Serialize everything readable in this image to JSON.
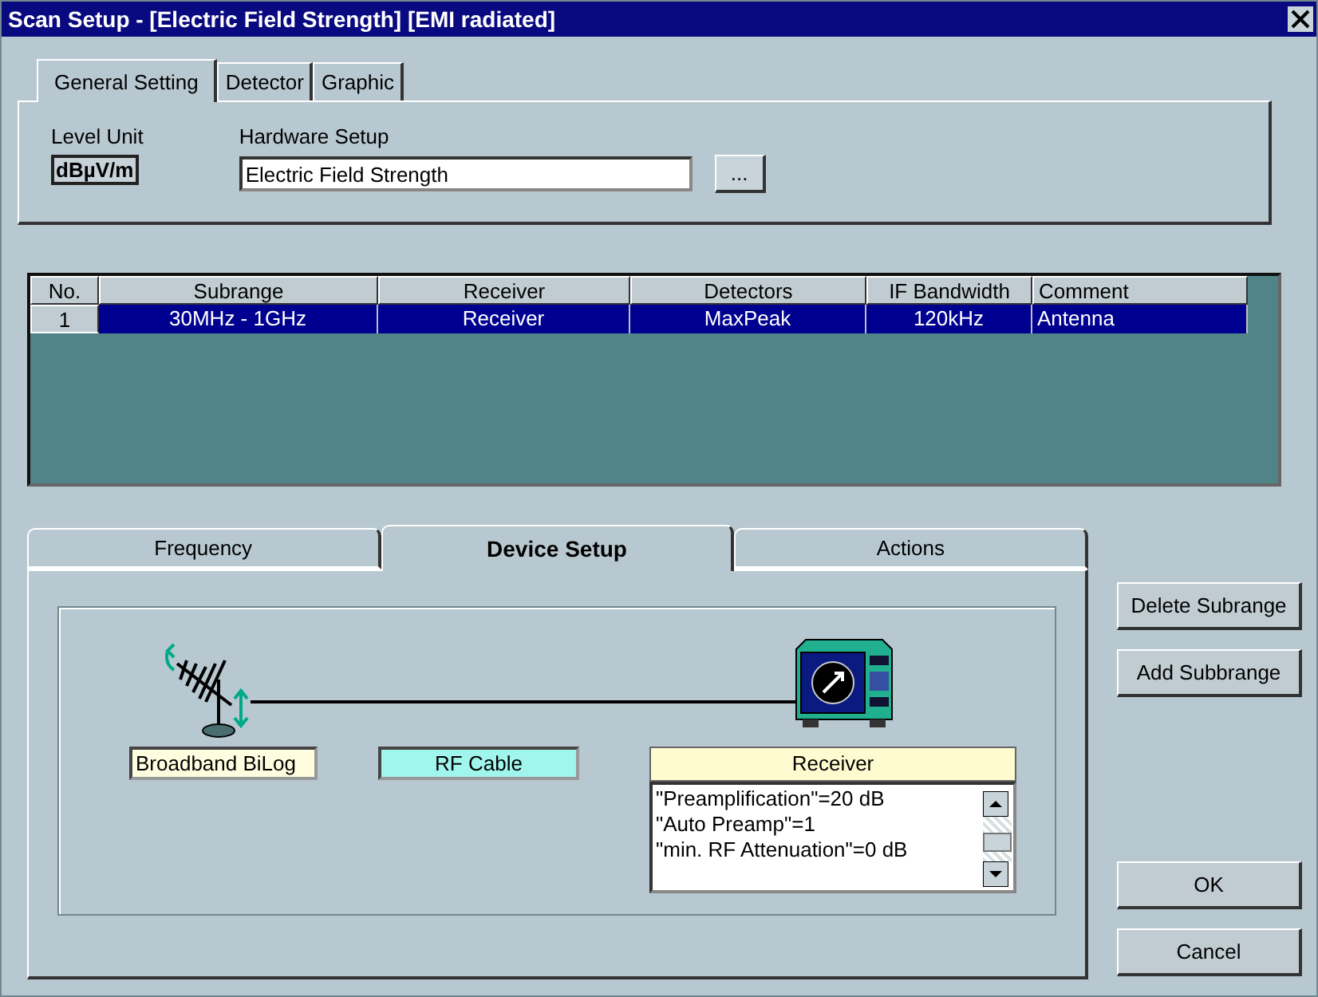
{
  "window": {
    "title": "Scan Setup - [Electric Field Strength] [EMI radiated]"
  },
  "top_tabs": [
    {
      "label": "General Setting",
      "selected": true
    },
    {
      "label": "Detector",
      "selected": false
    },
    {
      "label": "Graphic",
      "selected": false
    }
  ],
  "level_unit": {
    "label": "Level Unit",
    "value": "dBµV/m"
  },
  "hardware_setup": {
    "label": "Hardware Setup",
    "value": "Electric Field Strength",
    "browse_button": "..."
  },
  "table": {
    "columns": [
      "No.",
      "Subrange",
      "Receiver",
      "Detectors",
      "IF Bandwidth",
      "Comment"
    ],
    "rows": [
      {
        "cells": [
          "1",
          "30MHz - 1GHz",
          "Receiver",
          "MaxPeak",
          "120kHz",
          "Antenna"
        ],
        "selected": true
      }
    ]
  },
  "subrange_tabs": [
    {
      "label": "Frequency",
      "selected": false
    },
    {
      "label": "Device Setup",
      "selected": true
    },
    {
      "label": "Actions",
      "selected": false
    }
  ],
  "device_setup": {
    "antenna": "Broadband BiLog",
    "cable": "RF Cable",
    "receiver": {
      "title": "Receiver",
      "settings": [
        "\"Preamplification\"=20 dB",
        "\"Auto Preamp\"=1",
        "\"min. RF Attenuation\"=0 dB"
      ]
    }
  },
  "side_buttons": [
    "Delete Subrange",
    "Add Subbrange"
  ],
  "dialog_buttons": [
    "OK",
    "Cancel"
  ]
}
